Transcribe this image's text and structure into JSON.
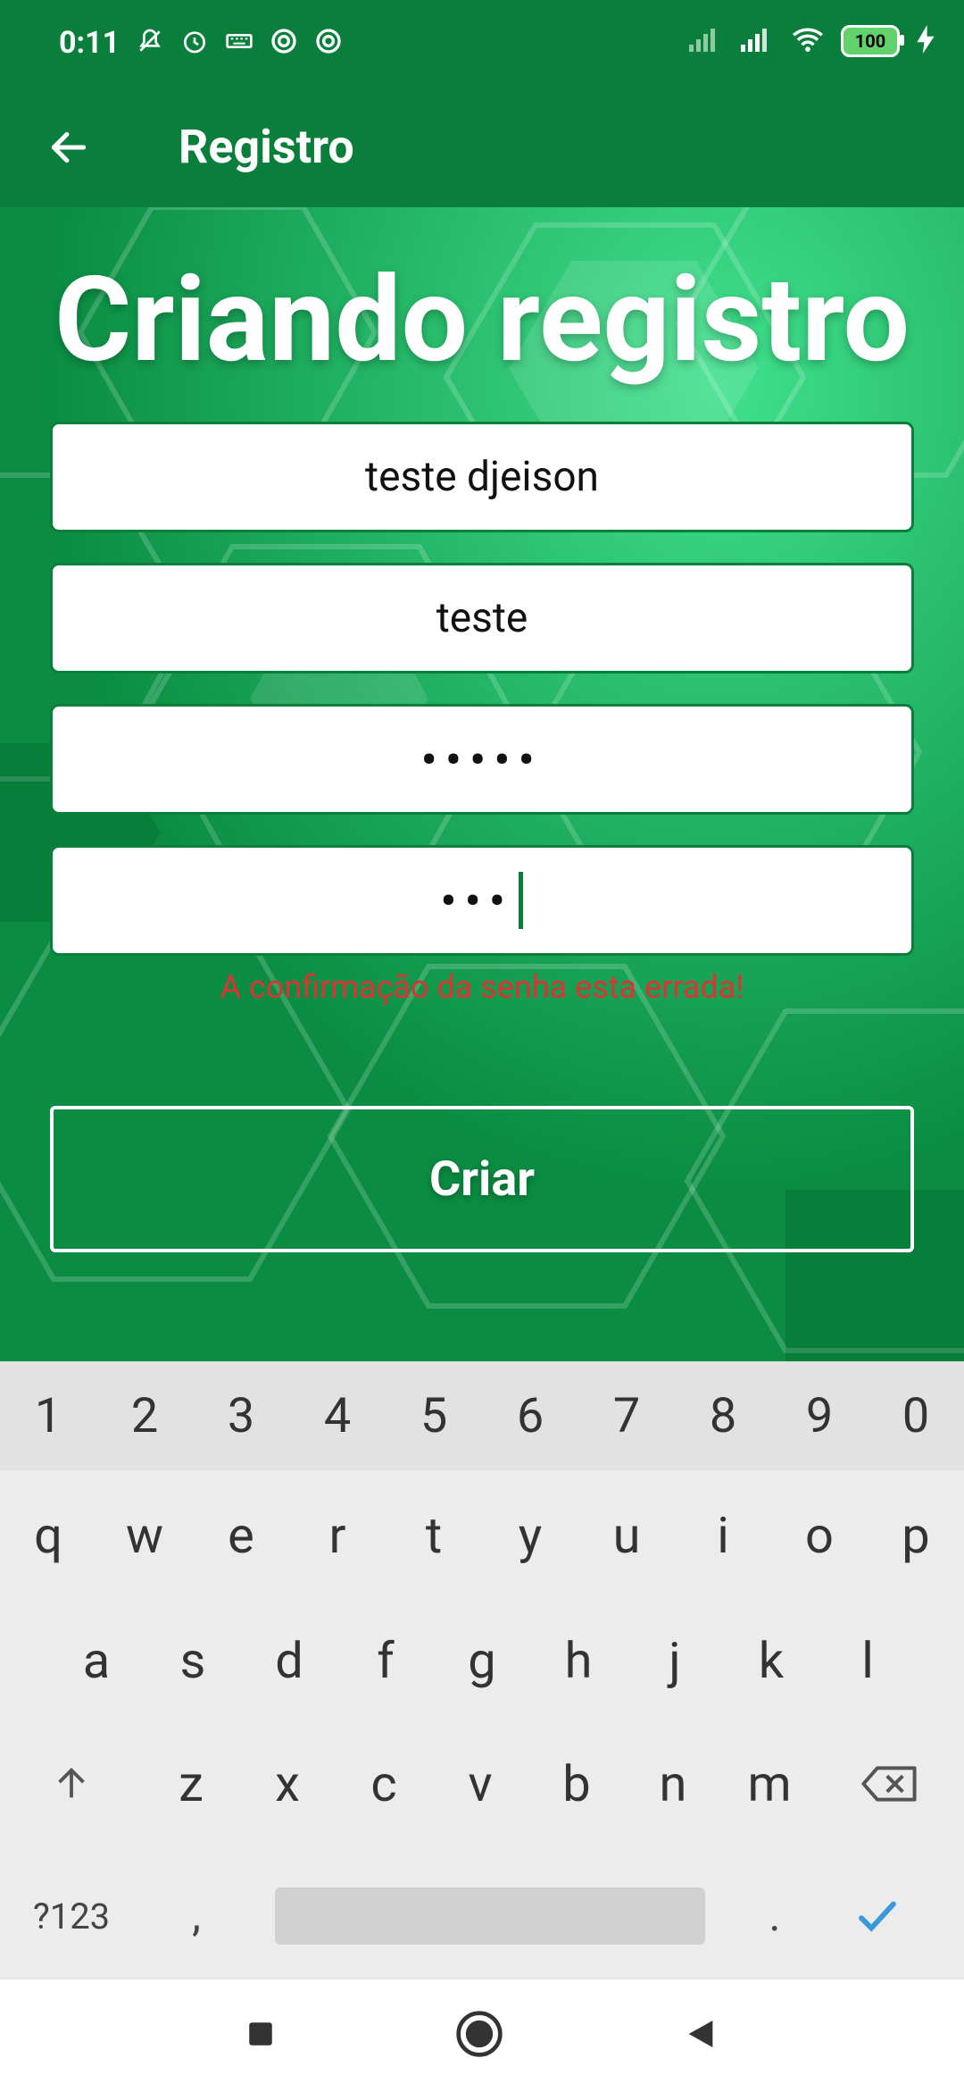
{
  "status_bar": {
    "time": "0:11",
    "battery": "100",
    "left_icons": [
      "mute-icon",
      "alarm-icon",
      "keyboard-icon",
      "vpn-icon",
      "vpn-icon"
    ],
    "right_icons": [
      "signal-no-sim-icon",
      "signal-icon",
      "wifi-icon",
      "battery-icon",
      "charging-icon"
    ]
  },
  "appbar": {
    "title": "Registro",
    "back_icon": "arrow-left-icon"
  },
  "main": {
    "headline": "Criando registro",
    "fields": [
      {
        "name": "name-field",
        "value": "teste djeison",
        "type": "text"
      },
      {
        "name": "username-field",
        "value": "teste",
        "type": "text"
      },
      {
        "name": "password-field",
        "value": "•••••",
        "type": "password"
      },
      {
        "name": "confirm-password-field",
        "value": "•••",
        "type": "password"
      }
    ],
    "error_message": "A confirmação da senha esta errada!",
    "create_button_label": "Criar"
  },
  "keyboard": {
    "numbers": [
      "1",
      "2",
      "3",
      "4",
      "5",
      "6",
      "7",
      "8",
      "9",
      "0"
    ],
    "row1": [
      "q",
      "w",
      "e",
      "r",
      "t",
      "y",
      "u",
      "i",
      "o",
      "p"
    ],
    "row2": [
      "a",
      "s",
      "d",
      "f",
      "g",
      "h",
      "j",
      "k",
      "l"
    ],
    "row3": [
      "z",
      "x",
      "c",
      "v",
      "b",
      "n",
      "m"
    ],
    "symbols_label": "?123",
    "comma": ",",
    "period": ".",
    "accent_color": "#3a9ad9"
  },
  "navbar": {
    "icons": [
      "square-icon",
      "home-circle-icon",
      "back-triangle-icon"
    ]
  },
  "colors": {
    "primary": "#0a7f3b",
    "accent": "#0ea24e",
    "error": "#d33333"
  }
}
